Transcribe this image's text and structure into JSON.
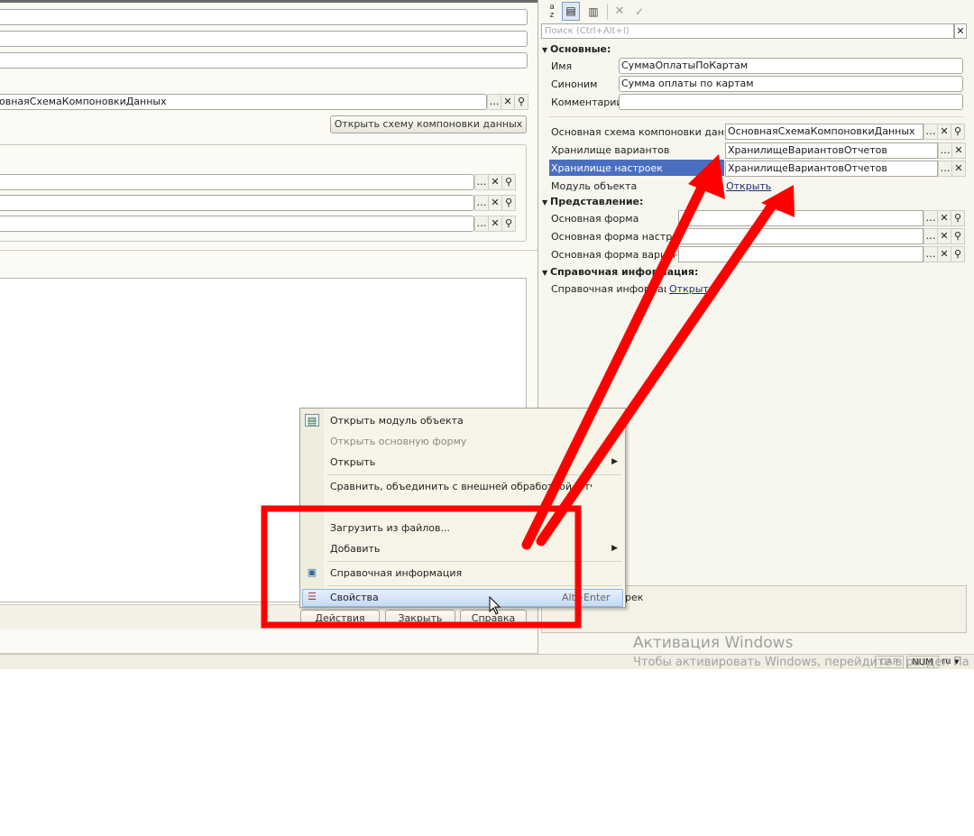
{
  "left_panel": {
    "data_scheme_value": "овнаяСхемаКомпоновкиДанных",
    "open_scheme_button": "Открыть схему компоновки данных",
    "bottom_buttons": [
      "Действия",
      "Закрыть",
      "Справка"
    ]
  },
  "properties": {
    "search_placeholder": "Поиск (Ctrl+Alt+I)",
    "sections": {
      "basic": "Основные:",
      "presentation": "Представление:",
      "reference": "Справочная информация:"
    },
    "name_label": "Имя",
    "name_value": "СуммаОплатыПоКартам",
    "synonym_label": "Синоним",
    "synonym_value": "Сумма оплаты по картам",
    "comment_label": "Комментарий",
    "comment_value": "",
    "main_scheme_label": "Основная схема компоновки данных",
    "main_scheme_value": "ОсновнаяСхемаКомпоновкиДанных",
    "variants_storage_label": "Хранилище вариантов",
    "variants_storage_value": "ХранилищеВариантовОтчетов",
    "settings_storage_label": "Хранилище настроек",
    "settings_storage_value": "ХранилищеВариантовОтчетов",
    "object_module_label": "Модуль объекта",
    "object_module_link": "Открыть",
    "main_form_label": "Основная форма",
    "main_settings_form_label": "Основная форма настроек",
    "main_variant_form_label": "Основная форма вариан",
    "reference_label": "Справочная информация",
    "reference_link": "Открыть",
    "bottom_text": "рек"
  },
  "context_menu": {
    "items": [
      "Открыть модуль объекта",
      "Открыть основную форму",
      "Открыть",
      "Сравнить, объединить с внешней обработкой, отчетом...",
      "Загрузить из файлов...",
      "Добавить",
      "Справочная информация",
      "Свойства"
    ],
    "properties_shortcut": "Alt+Enter"
  },
  "status_bar": {
    "cap": "CAP",
    "num": "NUM",
    "lang": "ru"
  },
  "watermark": {
    "title": "Активация Windows",
    "subtitle": "Чтобы активировать Windows, перейдите в раздел Па"
  },
  "annotation_color": "#ff0000",
  "highlight_color": "#4a6fc1"
}
